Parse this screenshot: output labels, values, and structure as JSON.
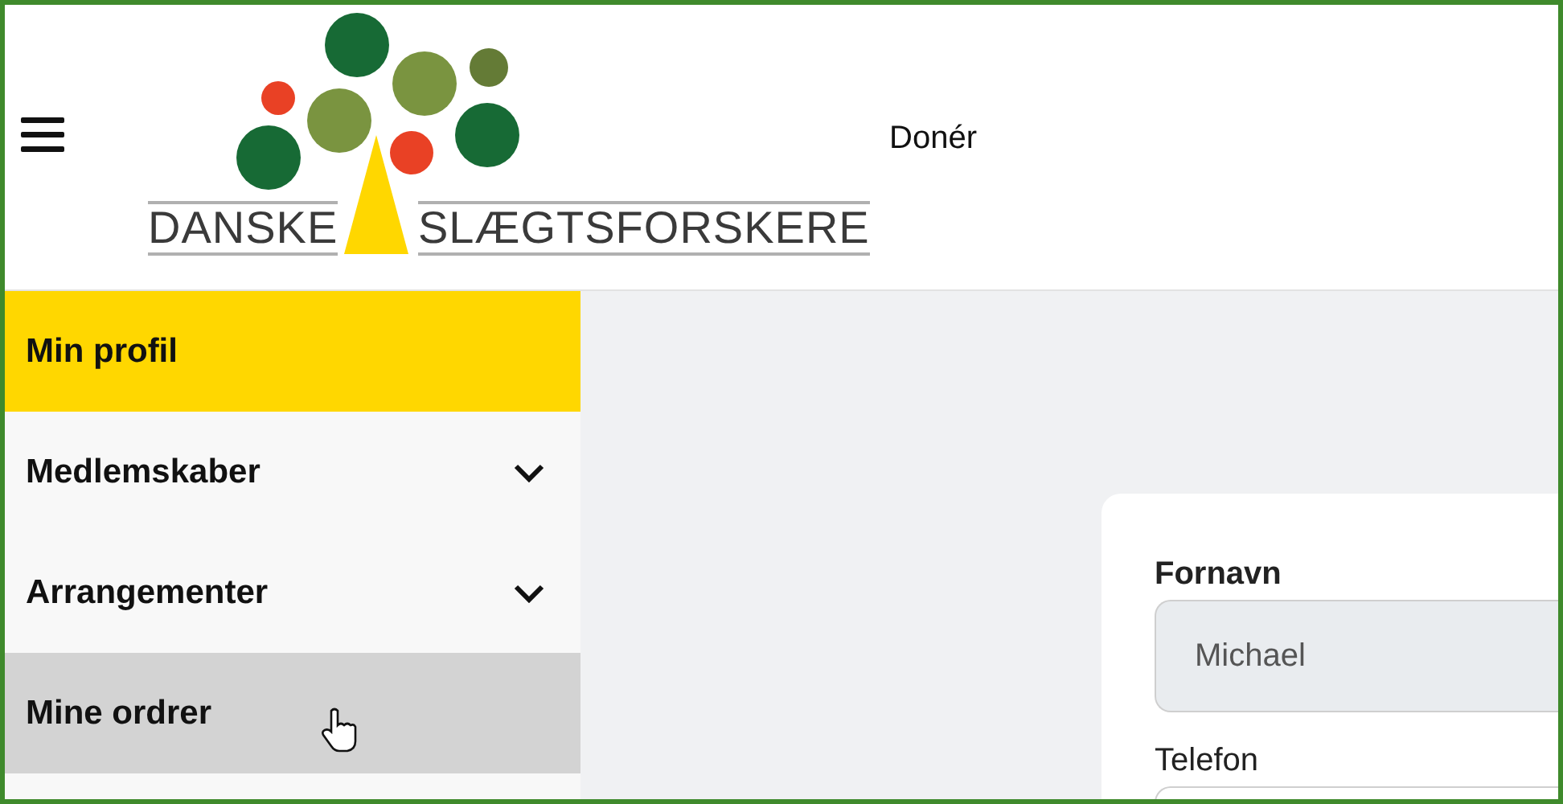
{
  "header": {
    "logo": {
      "left_text": "DANSKE",
      "right_text": "SLÆGTSFORSKERE"
    },
    "links": [
      {
        "label": "Donér"
      }
    ]
  },
  "sidebar": {
    "items": [
      {
        "label": "Min profil",
        "kind": "link",
        "selected": true,
        "hovered": false
      },
      {
        "label": "Medlemskaber",
        "kind": "group",
        "selected": false,
        "hovered": false
      },
      {
        "label": "Arrangementer",
        "kind": "group",
        "selected": false,
        "hovered": false
      },
      {
        "label": "Mine ordrer",
        "kind": "link",
        "selected": false,
        "hovered": true
      }
    ]
  },
  "form": {
    "fields": [
      {
        "label": "Fornavn",
        "value": "Michael",
        "disabled": true
      },
      {
        "label": "Telefon"
      }
    ]
  }
}
